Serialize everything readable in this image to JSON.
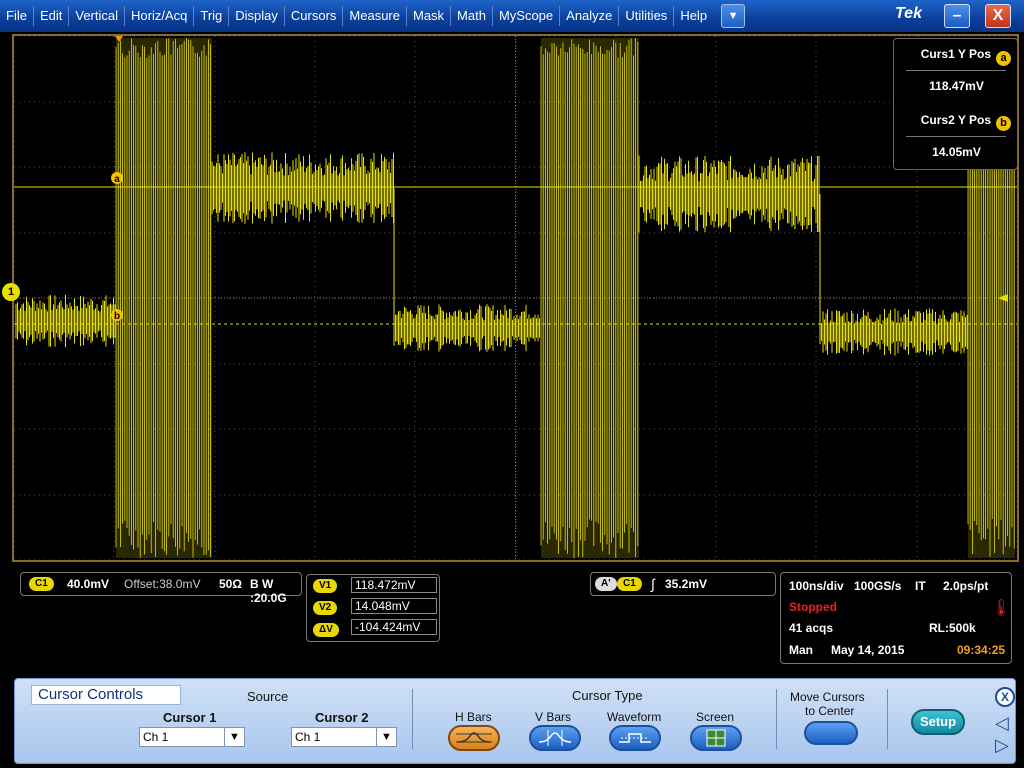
{
  "menu": [
    "File",
    "Edit",
    "Vertical",
    "Horiz/Acq",
    "Trig",
    "Display",
    "Cursors",
    "Measure",
    "Mask",
    "Math",
    "MyScope",
    "Analyze",
    "Utilities",
    "Help"
  ],
  "menu_dropdown_glyph": "▼",
  "logo": "Tek",
  "window": {
    "minimize": "–",
    "close": "X"
  },
  "colors": {
    "trace": "#e8e000",
    "menubar": "#0a3f9a",
    "panel": "#bcd3f0",
    "grid": "#555555"
  },
  "markers": {
    "channel": "1",
    "cursor_a": "a",
    "cursor_b": "b"
  },
  "cursor_readout": {
    "curs1_label": "Curs1 Y Pos",
    "curs1_badge": "a",
    "curs1_value": "118.47mV",
    "curs2_label": "Curs2 Y Pos",
    "curs2_badge": "b",
    "curs2_value": "14.05mV"
  },
  "channel_box": {
    "badge": "C1",
    "scale": "40.0mV",
    "offset": "Offset:38.0mV",
    "impedance": "50Ω",
    "bw": "B W :20.0G"
  },
  "cursor_values": {
    "v1_label": "V1",
    "v1": "118.472mV",
    "v2_label": "V2",
    "v2": "14.048mV",
    "dv_label": "ΔV",
    "dv": "-104.424mV"
  },
  "trigger": {
    "source_badge": "A'",
    "channel_badge": "C1",
    "level": "35.2mV"
  },
  "acquisition": {
    "timebase": "100ns/div",
    "sample_rate": "100GS/s",
    "mode": "IT",
    "resolution": "2.0ps/pt",
    "state": "Stopped",
    "acqs": "41 acqs",
    "record_length": "RL:500k",
    "trigger_mode": "Man",
    "date": "May 14, 2015",
    "time": "09:34:25"
  },
  "controls": {
    "title": "Cursor Controls",
    "source_label": "Source",
    "cursor1_label": "Cursor 1",
    "cursor1_value": "Ch 1",
    "cursor2_label": "Cursor 2",
    "cursor2_value": "Ch 1",
    "cursor_type_label": "Cursor Type",
    "types": [
      "H Bars",
      "V Bars",
      "Waveform",
      "Screen"
    ],
    "selected_type": "H Bars",
    "move_label_1": "Move Cursors",
    "move_label_2": "to Center",
    "setup_label": "Setup",
    "close_label": "X"
  }
}
